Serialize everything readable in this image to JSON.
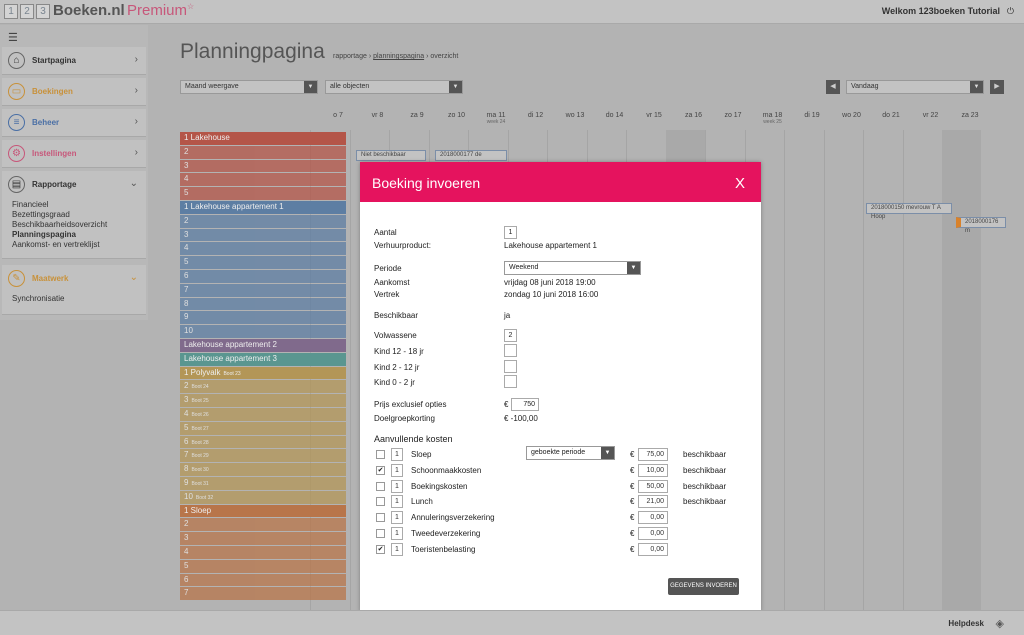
{
  "brand": {
    "box1": "1",
    "box2": "2",
    "box3": "3",
    "name": "Boeken.nl",
    "edition": "Premium",
    "star": "☆"
  },
  "header": {
    "welcome": "Welkom 123boeken Tutorial"
  },
  "sidebar": {
    "items": [
      {
        "label": "Startpagina",
        "icon": "home-icon",
        "color": "#555555"
      },
      {
        "label": "Boekingen",
        "icon": "bookings-icon",
        "color": "#c8913a"
      },
      {
        "label": "Beheer",
        "icon": "manage-icon",
        "color": "#4a6fa5"
      },
      {
        "label": "Instellingen",
        "icon": "settings-icon",
        "color": "#c7577a"
      },
      {
        "label": "Rapportage",
        "icon": "report-icon",
        "color": "#444444"
      },
      {
        "label": "Maatwerk",
        "icon": "custom-icon",
        "color": "#c8913a"
      }
    ],
    "rapportage_sub": [
      "Financieel",
      "Bezettingsgraad",
      "Beschikbaarheidsoverzicht",
      "Planningspagina",
      "Aankomst- en vertreklijst"
    ],
    "maatwerk_sub": [
      "Synchronisatie"
    ]
  },
  "page": {
    "title": "Planningpagina",
    "breadcrumb_1": "rapportage",
    "breadcrumb_sep": "›",
    "breadcrumb_2": "planningspagina",
    "breadcrumb_3": "overzicht",
    "view_select": "Maand weergave",
    "object_select": "alle objecten",
    "date_select": "Vandaag"
  },
  "calendar": {
    "days": [
      {
        "label": "o 7",
        "week": ""
      },
      {
        "label": "vr 8",
        "week": ""
      },
      {
        "label": "za 9",
        "week": ""
      },
      {
        "label": "zo 10",
        "week": ""
      },
      {
        "label": "ma 11",
        "week": "week 24"
      },
      {
        "label": "di 12",
        "week": ""
      },
      {
        "label": "wo 13",
        "week": ""
      },
      {
        "label": "do 14",
        "week": ""
      },
      {
        "label": "vr 15",
        "week": ""
      },
      {
        "label": "za 16",
        "week": ""
      },
      {
        "label": "zo 17",
        "week": ""
      },
      {
        "label": "ma 18",
        "week": "week 25"
      },
      {
        "label": "di 19",
        "week": ""
      },
      {
        "label": "wo 20",
        "week": ""
      },
      {
        "label": "do 21",
        "week": ""
      },
      {
        "label": "vr 22",
        "week": ""
      },
      {
        "label": "za 23",
        "week": ""
      }
    ],
    "groups": [
      {
        "name": "1 Lakehouse",
        "color": "#b45548",
        "rows": [
          "2",
          "3",
          "4",
          "5"
        ]
      },
      {
        "name": "1 Lakehouse appartement 1",
        "color": "#5d7ea3",
        "rows": [
          "2",
          "3",
          "4",
          "5",
          "6",
          "7",
          "8",
          "9",
          "10"
        ]
      },
      {
        "name": "Lakehouse appartement 2",
        "color": "#806a8c",
        "rows": []
      },
      {
        "name": "Lakehouse appartement 3",
        "color": "#5a9690",
        "rows": []
      },
      {
        "name": "1 Polyvalk",
        "sub": "Boot 23",
        "color": "#b39657",
        "rows": [
          "2",
          "3",
          "4",
          "5",
          "6",
          "7",
          "8",
          "9",
          "10"
        ],
        "boats": [
          "Boot 24",
          "Boot 25",
          "Boot 26",
          "Boot 27",
          "Boot 28",
          "Boot 29",
          "Boot 30",
          "Boot 31",
          "Boot 32"
        ]
      },
      {
        "name": "1 Sloep",
        "color": "#b8754a",
        "rows": [
          "2",
          "3",
          "4",
          "5",
          "6",
          "7"
        ]
      }
    ],
    "bookings": [
      {
        "text": "Niet beschikbaar"
      },
      {
        "text": "2018000177 de"
      },
      {
        "text": "2018000150 mevrouw T A Hoop"
      },
      {
        "text": "2018000176 m"
      }
    ]
  },
  "modal": {
    "title": "Boeking invoeren",
    "close": "X",
    "aantal_label": "Aantal",
    "aantal_value": "1",
    "product_label": "Verhuurproduct:",
    "product_value": "Lakehouse appartement 1",
    "periode_label": "Periode",
    "periode_value": "Weekend",
    "aankomst_label": "Aankomst",
    "aankomst_value": "vrijdag 08 juni 2018 19:00",
    "vertrek_label": "Vertrek",
    "vertrek_value": "zondag 10 juni 2018 16:00",
    "beschikbaar_label": "Beschikbaar",
    "beschikbaar_value": "ja",
    "volwassene_label": "Volwassene",
    "volwassene_value": "2",
    "kind1_label": "Kind 12 - 18 jr",
    "kind2_label": "Kind 2 - 12 jr",
    "kind3_label": "Kind 0 - 2 jr",
    "prijs_label": "Prijs exclusief opties",
    "prijs_currency": "€",
    "prijs_value": "750",
    "korting_label": "Doelgroepkorting",
    "korting_value": "€ -100,00",
    "kosten_heading": "Aanvullende kosten",
    "kosten_period_select": "geboekte periode",
    "kosten": [
      {
        "checked": false,
        "qty": "1",
        "name": "Sloep",
        "price": "75,00",
        "status": "beschikbaar"
      },
      {
        "checked": true,
        "qty": "1",
        "name": "Schoonmaakkosten",
        "price": "10,00",
        "status": "beschikbaar"
      },
      {
        "checked": false,
        "qty": "1",
        "name": "Boekingskosten",
        "price": "50,00",
        "status": "beschikbaar"
      },
      {
        "checked": false,
        "qty": "1",
        "name": "Lunch",
        "price": "21,00",
        "status": "beschikbaar"
      },
      {
        "checked": false,
        "qty": "1",
        "name": "Annuleringsverzekering",
        "price": "0,00",
        "status": ""
      },
      {
        "checked": false,
        "qty": "1",
        "name": "Tweedeverzekering",
        "price": "0,00",
        "status": ""
      },
      {
        "checked": true,
        "qty": "1",
        "name": "Toeristenbelasting",
        "price": "0,00",
        "status": ""
      }
    ],
    "currency": "€",
    "submit": "GEGEVENS INVOEREN"
  },
  "footer": {
    "helpdesk": "Helpdesk"
  },
  "colors": {
    "accent": "#e5135e",
    "overlay": "#b3b3b3"
  }
}
